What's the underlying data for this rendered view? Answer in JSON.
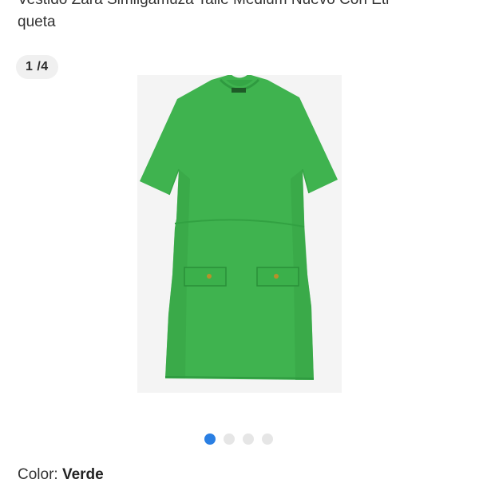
{
  "listing": {
    "title_line1": "Vestido Zara Similgamuza Talle Medium Nuevo Con Eti",
    "title_line2": "queta"
  },
  "gallery": {
    "counter": "1 /4",
    "image_icon": "green-dress-photo",
    "slides_total": 4,
    "active_slide": 1
  },
  "attributes": {
    "color_label": "Color: ",
    "color_value": "Verde"
  },
  "colors": {
    "dress": "#3fb34f",
    "active_dot": "#2a7fe3",
    "inactive_dot": "#e6e6e6"
  }
}
